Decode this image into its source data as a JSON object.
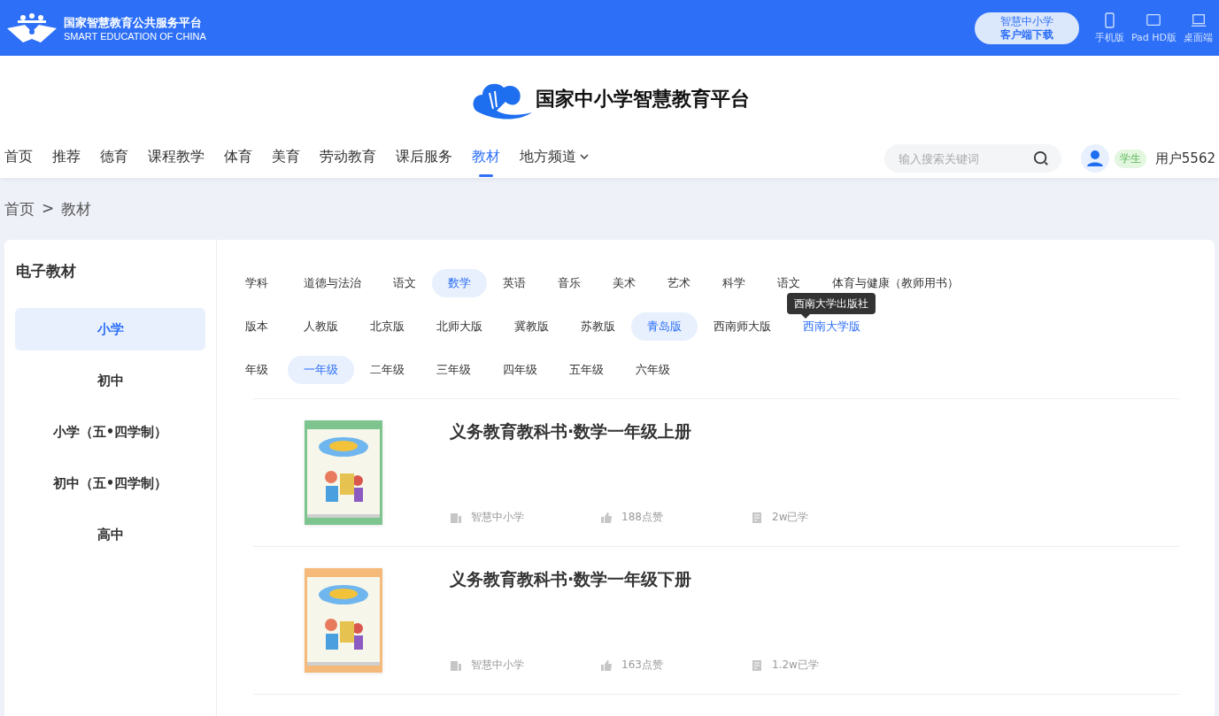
{
  "top_bar": {
    "brand_title": "国家智慧教育公共服务平台",
    "brand_subtitle": "SMART EDUCATION OF CHINA",
    "download_button": [
      "智慧中小学",
      "客户端下载"
    ],
    "devices": [
      {
        "kind": "phone",
        "label": "手机版"
      },
      {
        "kind": "tablet",
        "label": "Pad HD版"
      },
      {
        "kind": "desktop",
        "label": "桌面端"
      }
    ]
  },
  "header": {
    "logo_text": "国家中小学智慧教育平台",
    "nav": [
      {
        "label": "首页",
        "selected": false,
        "dropdown": false
      },
      {
        "label": "推荐",
        "selected": false,
        "dropdown": false
      },
      {
        "label": "德育",
        "selected": false,
        "dropdown": false
      },
      {
        "label": "课程教学",
        "selected": false,
        "dropdown": false
      },
      {
        "label": "体育",
        "selected": false,
        "dropdown": false
      },
      {
        "label": "美育",
        "selected": false,
        "dropdown": false
      },
      {
        "label": "劳动教育",
        "selected": false,
        "dropdown": false
      },
      {
        "label": "课后服务",
        "selected": false,
        "dropdown": false
      },
      {
        "label": "教材",
        "selected": true,
        "dropdown": false
      },
      {
        "label": "地方频道",
        "selected": false,
        "dropdown": true
      }
    ],
    "search": {
      "placeholder": "输入搜索关键词"
    },
    "user": {
      "role": "学生",
      "name": "用户5562"
    }
  },
  "breadcrumb": [
    "首页",
    ">",
    "教材"
  ],
  "sidebar": {
    "title": "电子教材",
    "items": [
      {
        "label": "小学",
        "selected": true
      },
      {
        "label": "初中",
        "selected": false
      },
      {
        "label": "小学（五•四学制）",
        "selected": false
      },
      {
        "label": "初中（五•四学制）",
        "selected": false
      },
      {
        "label": "高中",
        "selected": false
      }
    ]
  },
  "filters": [
    {
      "label": "学科",
      "options": [
        {
          "label": "道德与法治",
          "selected": false,
          "hovered": false
        },
        {
          "label": "语文",
          "selected": false,
          "hovered": false
        },
        {
          "label": "数学",
          "selected": true,
          "hovered": false
        },
        {
          "label": "英语",
          "selected": false,
          "hovered": false
        },
        {
          "label": "音乐",
          "selected": false,
          "hovered": false
        },
        {
          "label": "美术",
          "selected": false,
          "hovered": false
        },
        {
          "label": "艺术",
          "selected": false,
          "hovered": false
        },
        {
          "label": "科学",
          "selected": false,
          "hovered": false
        },
        {
          "label": "语文",
          "selected": false,
          "hovered": false
        },
        {
          "label": "体育与健康（教师用书）",
          "selected": false,
          "hovered": false
        }
      ]
    },
    {
      "label": "版本",
      "options": [
        {
          "label": "人教版",
          "selected": false,
          "hovered": false
        },
        {
          "label": "北京版",
          "selected": false,
          "hovered": false
        },
        {
          "label": "北师大版",
          "selected": false,
          "hovered": false
        },
        {
          "label": "冀教版",
          "selected": false,
          "hovered": false
        },
        {
          "label": "苏教版",
          "selected": false,
          "hovered": false
        },
        {
          "label": "青岛版",
          "selected": true,
          "hovered": false
        },
        {
          "label": "西南师大版",
          "selected": false,
          "hovered": false
        },
        {
          "label": "西南大学版",
          "selected": false,
          "hovered": true,
          "tooltip": "西南大学出版社"
        }
      ]
    },
    {
      "label": "年级",
      "options": [
        {
          "label": "一年级",
          "selected": true,
          "hovered": false
        },
        {
          "label": "二年级",
          "selected": false,
          "hovered": false
        },
        {
          "label": "三年级",
          "selected": false,
          "hovered": false
        },
        {
          "label": "四年级",
          "selected": false,
          "hovered": false
        },
        {
          "label": "五年级",
          "selected": false,
          "hovered": false
        },
        {
          "label": "六年级",
          "selected": false,
          "hovered": false
        }
      ]
    }
  ],
  "books": [
    {
      "title": "义务教育教科书·数学一年级上册",
      "publisher": "智慧中小学",
      "likes": "188点赞",
      "learners": "2w已学"
    },
    {
      "title": "义务教育教科书·数学一年级下册",
      "publisher": "智慧中小学",
      "likes": "163点赞",
      "learners": "1.2w已学"
    }
  ]
}
